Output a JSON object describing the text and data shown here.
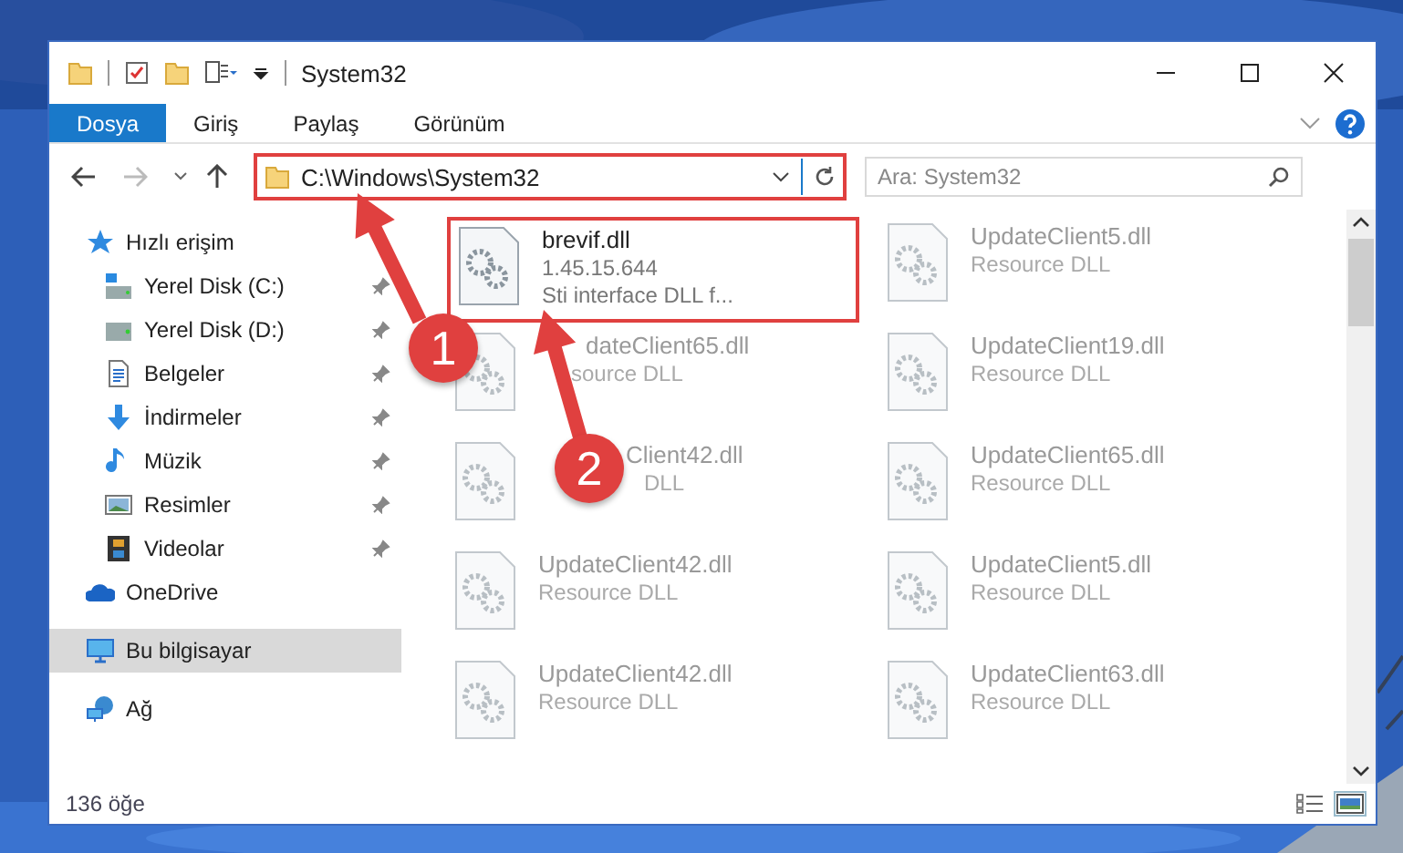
{
  "window": {
    "title": "System32"
  },
  "ribbon_tabs": [
    {
      "label": "Dosya",
      "selected": true
    },
    {
      "label": "Giriş",
      "selected": false
    },
    {
      "label": "Paylaş",
      "selected": false
    },
    {
      "label": "Görünüm",
      "selected": false
    }
  ],
  "address_bar": {
    "path": "C:\\Windows\\System32",
    "highlighted": true
  },
  "search": {
    "placeholder": "Ara: System32"
  },
  "sidebar": {
    "items": [
      {
        "label": "Hızlı erişim",
        "selected": false,
        "children": [
          {
            "label": "Yerel Disk (C:)",
            "pinned": true,
            "selected": false
          },
          {
            "label": "Yerel Disk (D:)",
            "pinned": true,
            "selected": false
          },
          {
            "label": "Belgeler",
            "pinned": true,
            "selected": false
          },
          {
            "label": "İndirmeler",
            "pinned": true,
            "selected": false
          },
          {
            "label": "Müzik",
            "pinned": true,
            "selected": false
          },
          {
            "label": "Resimler",
            "pinned": true,
            "selected": false
          },
          {
            "label": "Videolar",
            "pinned": true,
            "selected": false
          }
        ]
      },
      {
        "label": "OneDrive",
        "selected": false
      },
      {
        "label": "Bu bilgisayar",
        "selected": true
      },
      {
        "label": "Ağ",
        "selected": false
      }
    ]
  },
  "files": [
    {
      "name": "brevif.dll",
      "version": "1.45.15.644",
      "description": "Sti interface DLL f...",
      "highlighted": true,
      "blurred": false
    },
    {
      "name": "UpdateClient5.dll",
      "description": "Resource DLL",
      "highlighted": false,
      "blurred": true
    },
    {
      "name": "dateClient65.dll",
      "description": "source DLL",
      "highlighted": false,
      "blurred": true
    },
    {
      "name": "UpdateClient19.dll",
      "description": "Resource DLL",
      "highlighted": false,
      "blurred": true
    },
    {
      "name": "Client42.dll",
      "description": "DLL",
      "highlighted": false,
      "blurred": true
    },
    {
      "name": "UpdateClient65.dll",
      "description": "Resource DLL",
      "highlighted": false,
      "blurred": true
    },
    {
      "name": "UpdateClient42.dll",
      "description": "Resource DLL",
      "highlighted": false,
      "blurred": true
    },
    {
      "name": "UpdateClient5.dll",
      "description": "Resource DLL",
      "highlighted": false,
      "blurred": true
    },
    {
      "name": "UpdateClient42.dll",
      "description": "Resource DLL",
      "highlighted": false,
      "blurred": true
    },
    {
      "name": "UpdateClient63.dll",
      "description": "Resource DLL",
      "highlighted": false,
      "blurred": true
    }
  ],
  "status_bar": {
    "item_count": "136 öğe"
  },
  "annotations": [
    {
      "label": "1"
    },
    {
      "label": "2"
    }
  ]
}
